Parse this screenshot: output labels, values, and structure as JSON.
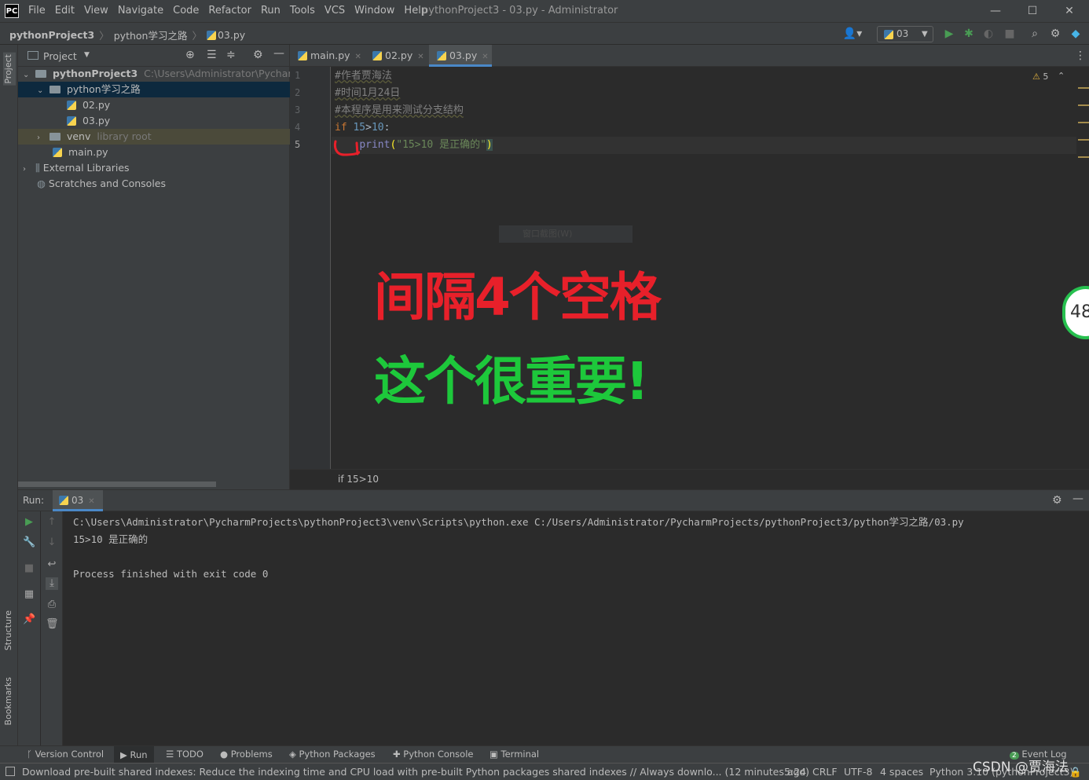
{
  "app": {
    "logo": "PC",
    "window_title": "pythonProject3 - 03.py - Administrator",
    "menu": [
      "File",
      "Edit",
      "View",
      "Navigate",
      "Code",
      "Refactor",
      "Run",
      "Tools",
      "VCS",
      "Window",
      "Help"
    ]
  },
  "navbar": {
    "breadcrumb": [
      "pythonProject3",
      "python学习之路",
      "03.py"
    ],
    "run_config": "03"
  },
  "left_strip": {
    "tabs": [
      "Project",
      "Structure",
      "Bookmarks"
    ]
  },
  "project": {
    "title": "Project",
    "tree": [
      {
        "label": "pythonProject3",
        "path": "C:\\Users\\Administrator\\PycharmPro"
      },
      {
        "label": "python学习之路"
      },
      {
        "label": "02.py"
      },
      {
        "label": "03.py"
      },
      {
        "label": "venv",
        "hint": "library root"
      },
      {
        "label": "main.py"
      },
      {
        "label": "External Libraries"
      },
      {
        "label": "Scratches and Consoles"
      }
    ]
  },
  "editor": {
    "tabs": [
      "main.py",
      "02.py",
      "03.py"
    ],
    "line_numbers": [
      "1",
      "2",
      "3",
      "4",
      "5"
    ],
    "lines": {
      "l1": "#作者贾海法",
      "l2": "#时间1月24日",
      "l3": "#本程序是用来测试分支结构",
      "l4_kw": "if",
      "l4_num1": "15",
      "l4_op": ">",
      "l4_num2": "10",
      "l4_colon": ":",
      "l5_fn": "print",
      "l5_open": "(",
      "l5_str": "\"15>10 是正确的\"",
      "l5_close": ")"
    },
    "warnings": "5",
    "footer_breadcrumb": "if 15>10",
    "ghost_tooltip": "窗口截图(W)"
  },
  "annotations": {
    "line1": "间隔4个空格",
    "line2": "这个很重要!",
    "side_widget": "48"
  },
  "run": {
    "label": "Run:",
    "tab": "03",
    "console": [
      "C:\\Users\\Administrator\\PycharmProjects\\pythonProject3\\venv\\Scripts\\python.exe C:/Users/Administrator/PycharmProjects/pythonProject3/python学习之路/03.py",
      "15>10 是正确的",
      "",
      "Process finished with exit code 0"
    ]
  },
  "tool_tabs": [
    "Version Control",
    "Run",
    "TODO",
    "Problems",
    "Python Packages",
    "Python Console",
    "Terminal"
  ],
  "event_log": {
    "count": "2",
    "label": "Event Log"
  },
  "status": {
    "message": "Download pre-built shared indexes: Reduce the indexing time and CPU load with pre-built Python packages shared indexes // Always downlo... (12 minutes ago)",
    "position": "5:24",
    "line_sep": "CRLF",
    "encoding": "UTF-8",
    "indent": "4 spaces",
    "interpreter": "Python 3.10 (pythonProject3)"
  },
  "watermark": "CSDN @贾海法",
  "colors": {
    "accent": "#4a88c7",
    "annotation_red": "#e8202a",
    "annotation_green": "#1dc83b",
    "run_green": "#499c54"
  }
}
